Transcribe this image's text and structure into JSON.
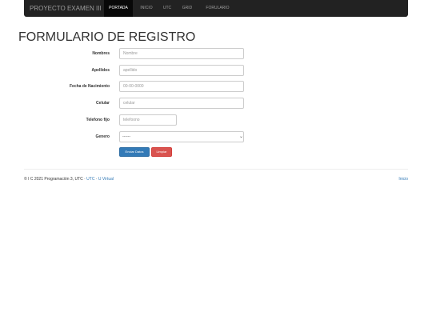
{
  "navbar": {
    "brand": "PROYECTO EXAMEN III",
    "items": [
      {
        "label": "PORTADA",
        "active": true
      },
      {
        "label": "INICIO",
        "active": false
      },
      {
        "label": "UTC",
        "active": false
      },
      {
        "label": "GRID",
        "active": false
      },
      {
        "label": "FORULARIO",
        "active": false
      }
    ]
  },
  "page": {
    "title": "FORMULARIO DE REGISTRO"
  },
  "form": {
    "nombres": {
      "label": "Nombres",
      "placeholder": "Nombre",
      "value": ""
    },
    "apellidos": {
      "label": "Apellidos",
      "placeholder": "apellido",
      "value": ""
    },
    "fecha_nacimiento": {
      "label": "Fecha de Nacimiento",
      "placeholder": "00-00-0000",
      "value": ""
    },
    "celular": {
      "label": "Celular",
      "placeholder": "celular",
      "value": ""
    },
    "telefono_fijo": {
      "label": "Telefono fijo",
      "placeholder": "telefoono",
      "value": ""
    },
    "genero": {
      "label": "Genero",
      "selected": "------"
    },
    "submit_label": "Enviar Datos",
    "reset_label": "Limpiar"
  },
  "footer": {
    "copyright": "© I C 2021 Programación 3, UTC · ",
    "link_utc": "UTC",
    "separator": " · ",
    "link_uvirtual": "U Virtual",
    "link_inicio": "Inicio"
  },
  "colors": {
    "navbar_bg": "#222222",
    "primary": "#337ab7",
    "danger": "#d9534f"
  }
}
